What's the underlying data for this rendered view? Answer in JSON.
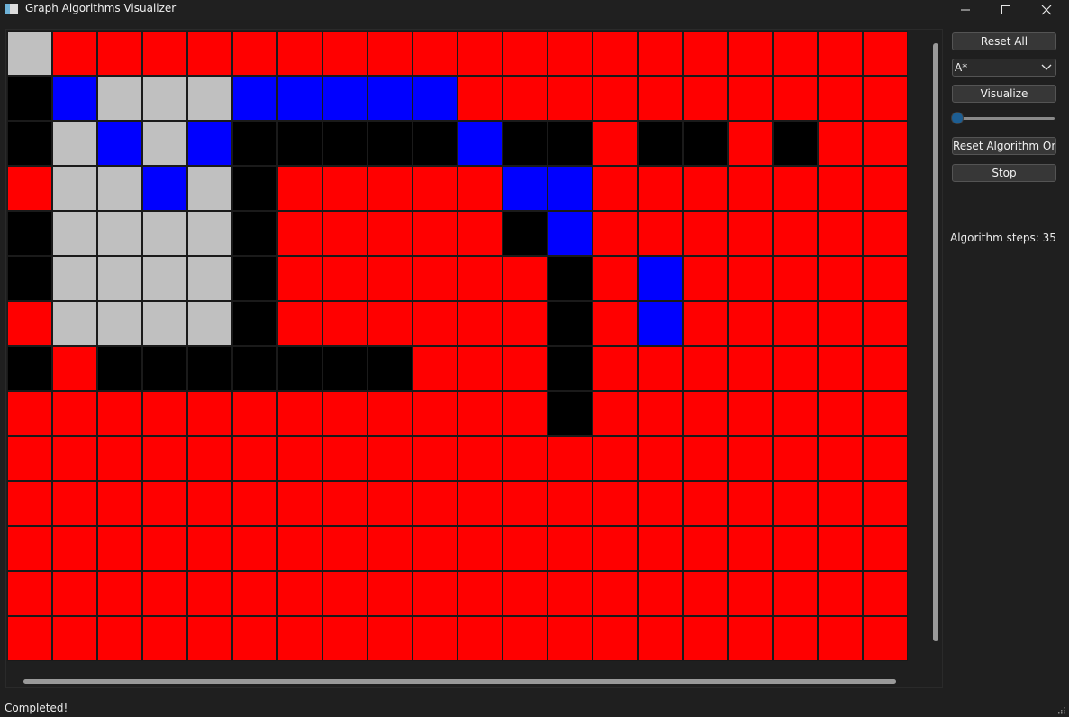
{
  "window": {
    "title": "Graph Algorithms Visualizer",
    "controls": [
      "minimize",
      "maximize",
      "close"
    ]
  },
  "controls": {
    "reset_all": "Reset All",
    "algorithm": {
      "selected": "A*"
    },
    "visualize": "Visualize",
    "speed_slider": {
      "value": 0
    },
    "reset_algorithm_only": "Reset Algorithm Only",
    "stop": "Stop"
  },
  "info": {
    "algorithm_steps": "Algorithm steps: 35"
  },
  "status_bar": {
    "message": "Completed!"
  },
  "colors": {
    "V": "#ff0000",
    "P": "#0000ff",
    "W": "#000000",
    "G": "#c0c0c0"
  },
  "grid": {
    "rows": 14,
    "cols": 20,
    "legend": {
      "V": "visited",
      "P": "path",
      "W": "wall",
      "G": "unvisited"
    },
    "cells": [
      "GVVVVVVVVVVVVVVVVVVV",
      "WPGGGPPPPPVVVVVVVVVV",
      "WGPGPWWWWWPWWVWWVWVV",
      "VGGPGWVVVVVPPVVVVVVV",
      "WGGGGWVVVVVWPVVVVVVV",
      "WGGGGWVVVVVVWVPVVVVV",
      "VGGGGWVVVVVVWVPVVVVV",
      "WVWWWWWWWVVVWVVVVVVV",
      "VVVVVVVVVVVVWVVVVVVV",
      "VVVVVVVVVVVVVVVVVVVV",
      "VVVVVVVVVVVVVVVVVVVV",
      "VVVVVVVVVVVVVVVVVVVV",
      "VVVVVVVVVVVVVVVVVVVV",
      "VVVVVVVVVVVVVVVVVVVV"
    ]
  }
}
